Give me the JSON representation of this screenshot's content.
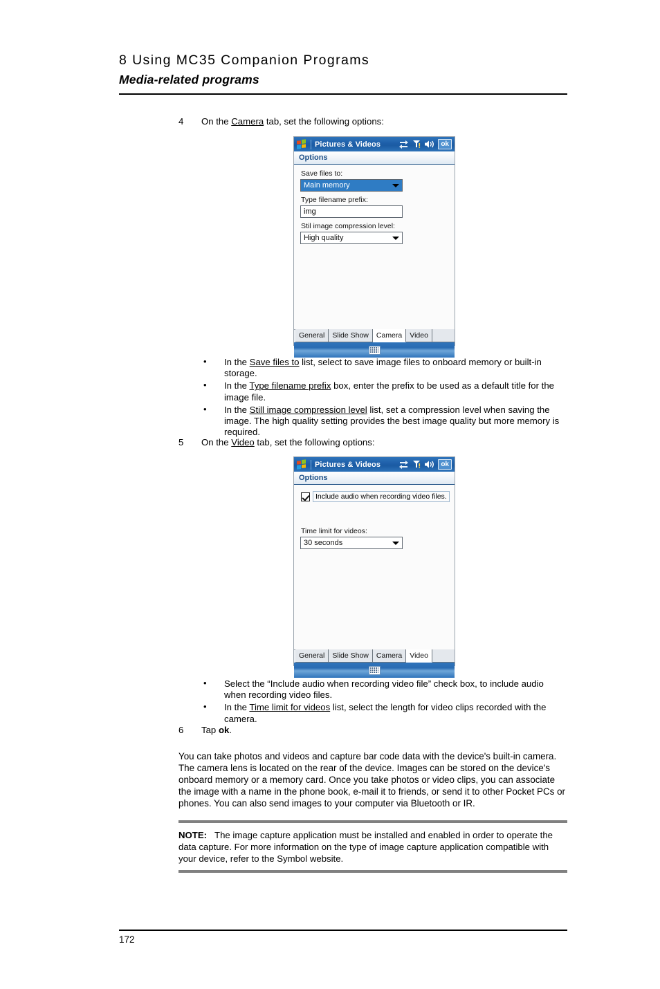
{
  "header": {
    "chapter_title": "8 Using MC35 Companion Programs",
    "section_title": "Media-related programs"
  },
  "steps": {
    "step4": {
      "number": "4",
      "text_before": "On the ",
      "underlined": "Camera",
      "text_after": " tab, set the following options:"
    },
    "step5": {
      "number": "5",
      "text_before": "On the ",
      "underlined": "Video",
      "text_after": " tab, set the following options:"
    },
    "step6": {
      "number": "6",
      "text_before": "Tap ",
      "bold": "ok",
      "text_after": "."
    }
  },
  "bullets_camera": [
    {
      "marker": "•",
      "pre": "In the ",
      "link": "Save files to",
      "post": " list, select to save image files to onboard memory or built-in storage."
    },
    {
      "marker": "•",
      "pre": "In the ",
      "link": "Type filename prefix",
      "post": " box, enter the prefix to be used as a default title for the image file."
    },
    {
      "marker": "•",
      "pre": "In the ",
      "link": "Still image compression level",
      "post": " list, set a compression level when saving the image. The high quality setting provides the best image quality but more memory is required."
    }
  ],
  "bullets_video": [
    {
      "marker": "•",
      "pre": "Select the “Include audio when recording video file” check box, to include audio when recording video files.",
      "link": "",
      "post": ""
    },
    {
      "marker": "•",
      "pre": "In the ",
      "link": "Time limit for videos",
      "post": " list, select the length for video clips recorded with the camera."
    }
  ],
  "body_paragraph": "You can take photos and videos and capture bar code data with the device's built-in camera. The camera lens is located on the rear of the device. Images can be stored on the device's onboard memory or a memory card. Once you take photos or video clips, you can associate the image with a name in the phone book, e-mail it to friends, or send it to other Pocket PCs or phones. You can also send images to your computer via Bluetooth or IR.",
  "note": {
    "label": "NOTE:",
    "text": "The image capture application must be installed and enabled in order to operate the data capture. For more information on the type of image capture application compatible with your device, refer to the Symbol website."
  },
  "footer": {
    "page_number": "172"
  },
  "screenshot_camera": {
    "title": "Pictures & Videos",
    "ok_label": "ok",
    "subbar_title": "Options",
    "fields": {
      "save_files_to_label": "Save files to:",
      "save_files_to_value": "Main memory",
      "filename_prefix_label": "Type filename prefix:",
      "filename_prefix_value": "img",
      "compression_label": "Stil image compression level:",
      "compression_value": "High quality"
    },
    "tabs": [
      {
        "label": "General",
        "active": false
      },
      {
        "label": "Slide Show",
        "active": false
      },
      {
        "label": "Camera",
        "active": true
      },
      {
        "label": "Video",
        "active": false
      }
    ],
    "icons": [
      "connectivity-icon",
      "signal-icon",
      "volume-icon",
      "ok-button",
      "sip-keyboard-icon"
    ]
  },
  "screenshot_video": {
    "title": "Pictures & Videos",
    "ok_label": "ok",
    "subbar_title": "Options",
    "fields": {
      "include_audio_label": "Include audio when recording video files.",
      "include_audio_checked": true,
      "time_limit_label": "Time limit for videos:",
      "time_limit_value": "30 seconds"
    },
    "tabs": [
      {
        "label": "General",
        "active": false
      },
      {
        "label": "Slide Show",
        "active": false
      },
      {
        "label": "Camera",
        "active": false
      },
      {
        "label": "Video",
        "active": true
      }
    ],
    "icons": [
      "connectivity-icon",
      "signal-icon",
      "volume-icon",
      "ok-button",
      "sip-keyboard-icon"
    ]
  },
  "colors": {
    "titlebar_blue": "#1d5ea8",
    "selection_blue": "#2f7cc4",
    "subbar_text": "#1c4f86",
    "note_rule": "#808080"
  }
}
